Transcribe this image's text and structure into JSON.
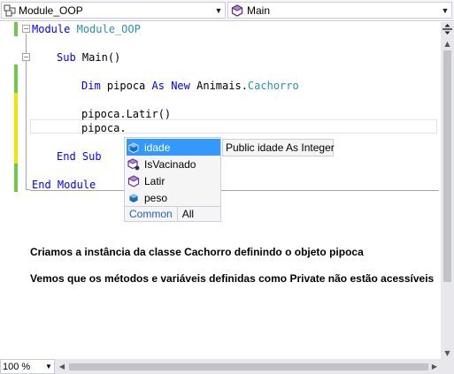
{
  "nav": {
    "left_combo": {
      "label": "Module_OOP",
      "icon": "module-icon"
    },
    "right_combo": {
      "label": "Main",
      "icon": "method-icon"
    }
  },
  "code": {
    "line1": {
      "kw": "Module",
      "name": "Module_OOP"
    },
    "line3": {
      "kw": "Sub",
      "rest": "Main()"
    },
    "line5": {
      "kw1": "Dim",
      "mid1": "pipoca",
      "kw2": "As",
      "kw3": "New",
      "mid2": "Animais.",
      "type": "Cachorro"
    },
    "line7": {
      "text": "pipoca.Latir()"
    },
    "line8": {
      "text": "pipoca."
    },
    "line10": {
      "kw": "End Sub"
    },
    "line12": {
      "kw": "End Module"
    }
  },
  "intellisense": {
    "items": [
      {
        "label": "idade",
        "icon": "field-icon",
        "selected": true
      },
      {
        "label": "IsVacinado",
        "icon": "method-extension-icon",
        "selected": false
      },
      {
        "label": "Latir",
        "icon": "method-icon",
        "selected": false
      },
      {
        "label": "peso",
        "icon": "field-icon",
        "selected": false
      }
    ],
    "tabs": [
      "Common",
      "All"
    ],
    "tooltip": "Public idade As Integer"
  },
  "description": {
    "line1": "Criamos a instância da classe Cachorro definindo o objeto pipoca",
    "line2": "Vemos que os métodos e variáveis definidas como Private não estão acessíveis"
  },
  "status": {
    "zoom": "100 %"
  },
  "colors": {
    "keyword": "#0000ff",
    "type": "#2b91af",
    "selection": "#3399ff",
    "change_saved": "#6ec94a",
    "change_unsaved": "#f2e400"
  }
}
